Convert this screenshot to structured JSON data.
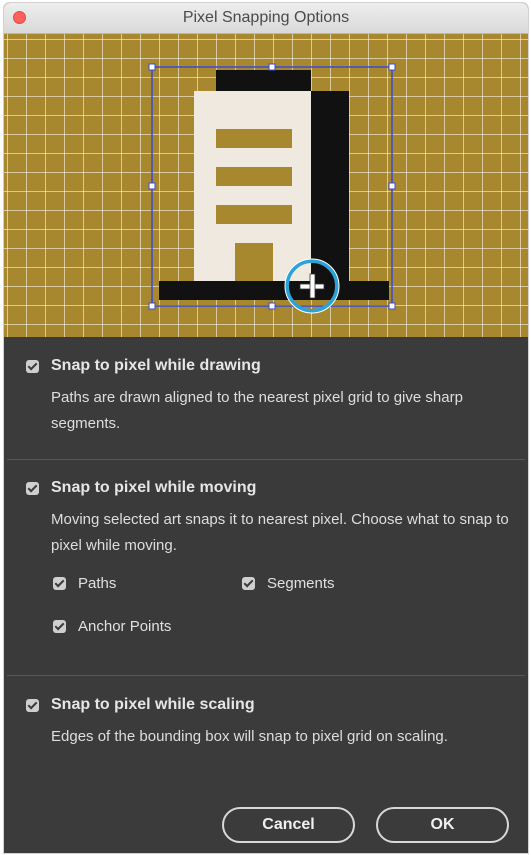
{
  "window": {
    "title": "Pixel Snapping Options"
  },
  "colors": {
    "preview_background": "#a8882e",
    "dialog_background": "#3b3b3b",
    "selection_box": "#3a4bd6",
    "cursor_ring": "#2aa3d8",
    "building_light": "#efe9df",
    "building_dark": "#111111"
  },
  "preview": {
    "icon": "building-icon",
    "cursor": "snap-crosshair-icon"
  },
  "options": {
    "drawing": {
      "label": "Snap to pixel while drawing",
      "checked": true,
      "description": "Paths are drawn aligned to the nearest pixel grid to give sharp segments."
    },
    "moving": {
      "label": "Snap to pixel while moving",
      "checked": true,
      "description": "Moving selected art snaps it to nearest pixel. Choose what to snap to pixel while moving.",
      "sub_options": {
        "paths": {
          "label": "Paths",
          "checked": true
        },
        "segments": {
          "label": "Segments",
          "checked": true
        },
        "anchor_points": {
          "label": "Anchor Points",
          "checked": true
        }
      }
    },
    "scaling": {
      "label": "Snap to pixel while scaling",
      "checked": true,
      "description": "Edges of the bounding box will snap to pixel grid on scaling."
    }
  },
  "buttons": {
    "cancel": "Cancel",
    "ok": "OK"
  }
}
